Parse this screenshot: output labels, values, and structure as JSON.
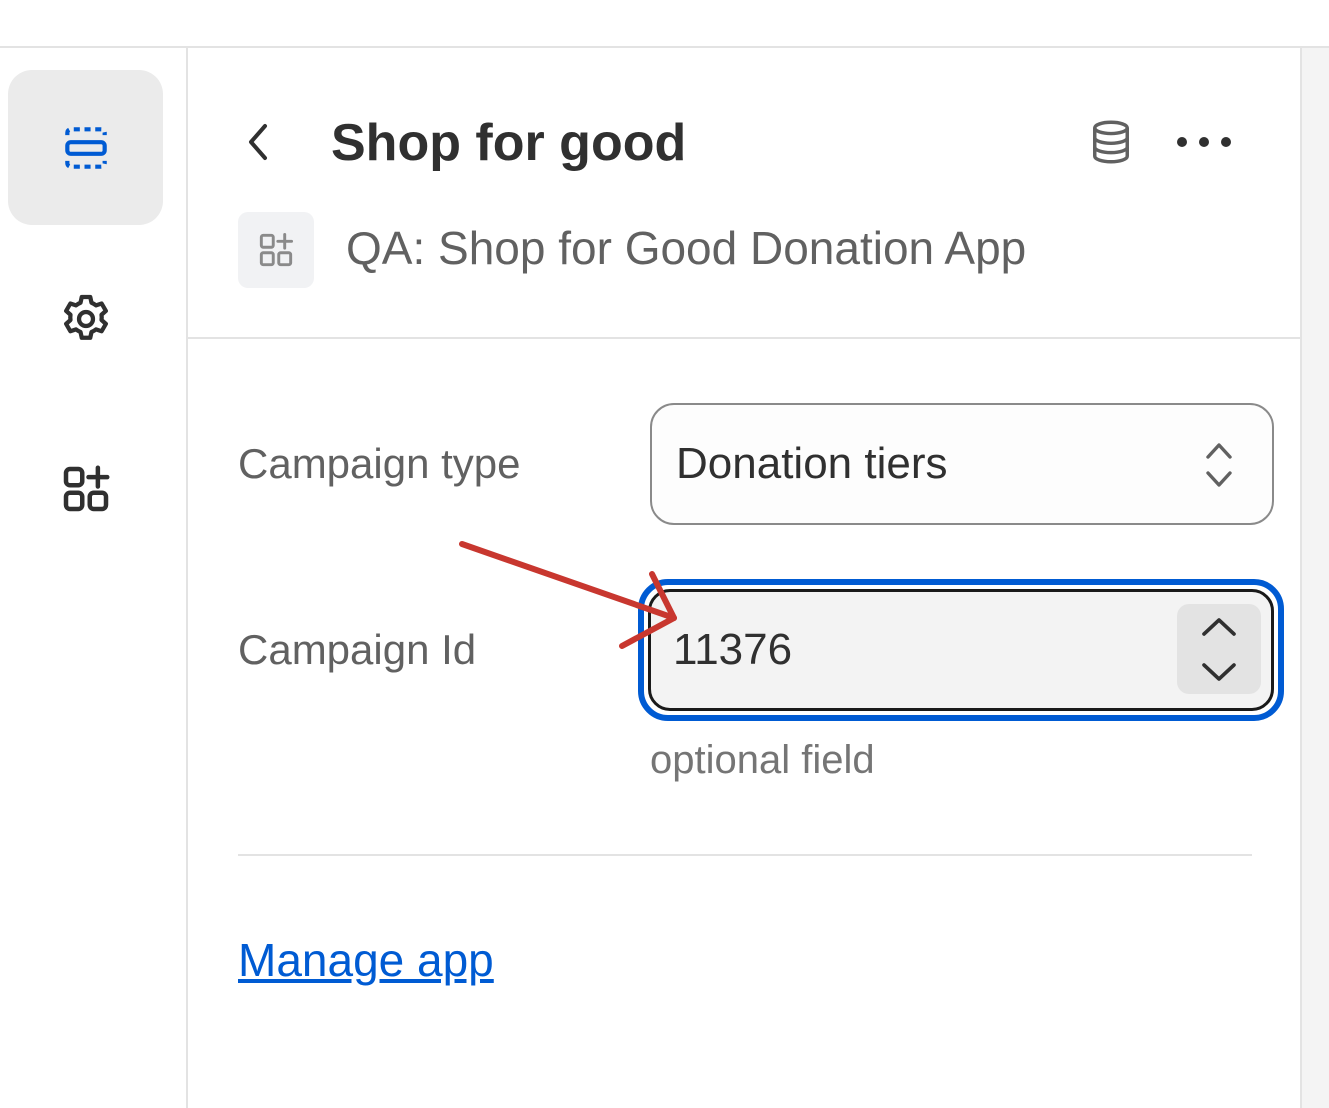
{
  "header": {
    "title": "Shop for good",
    "subtitle": "QA: Shop for Good Donation App"
  },
  "sidebar": {
    "items": [
      {
        "icon": "sections-icon",
        "active": true
      },
      {
        "icon": "gear-icon",
        "active": false
      },
      {
        "icon": "apps-icon",
        "active": false
      }
    ]
  },
  "form": {
    "campaign_type": {
      "label": "Campaign type",
      "value": "Donation tiers"
    },
    "campaign_id": {
      "label": "Campaign Id",
      "value": "11376",
      "help": "optional field"
    }
  },
  "links": {
    "manage_app": "Manage app"
  },
  "colors": {
    "accent": "#005bd3",
    "annotation_arrow": "#c8372f",
    "text_primary": "#303030",
    "text_secondary": "#616161"
  }
}
